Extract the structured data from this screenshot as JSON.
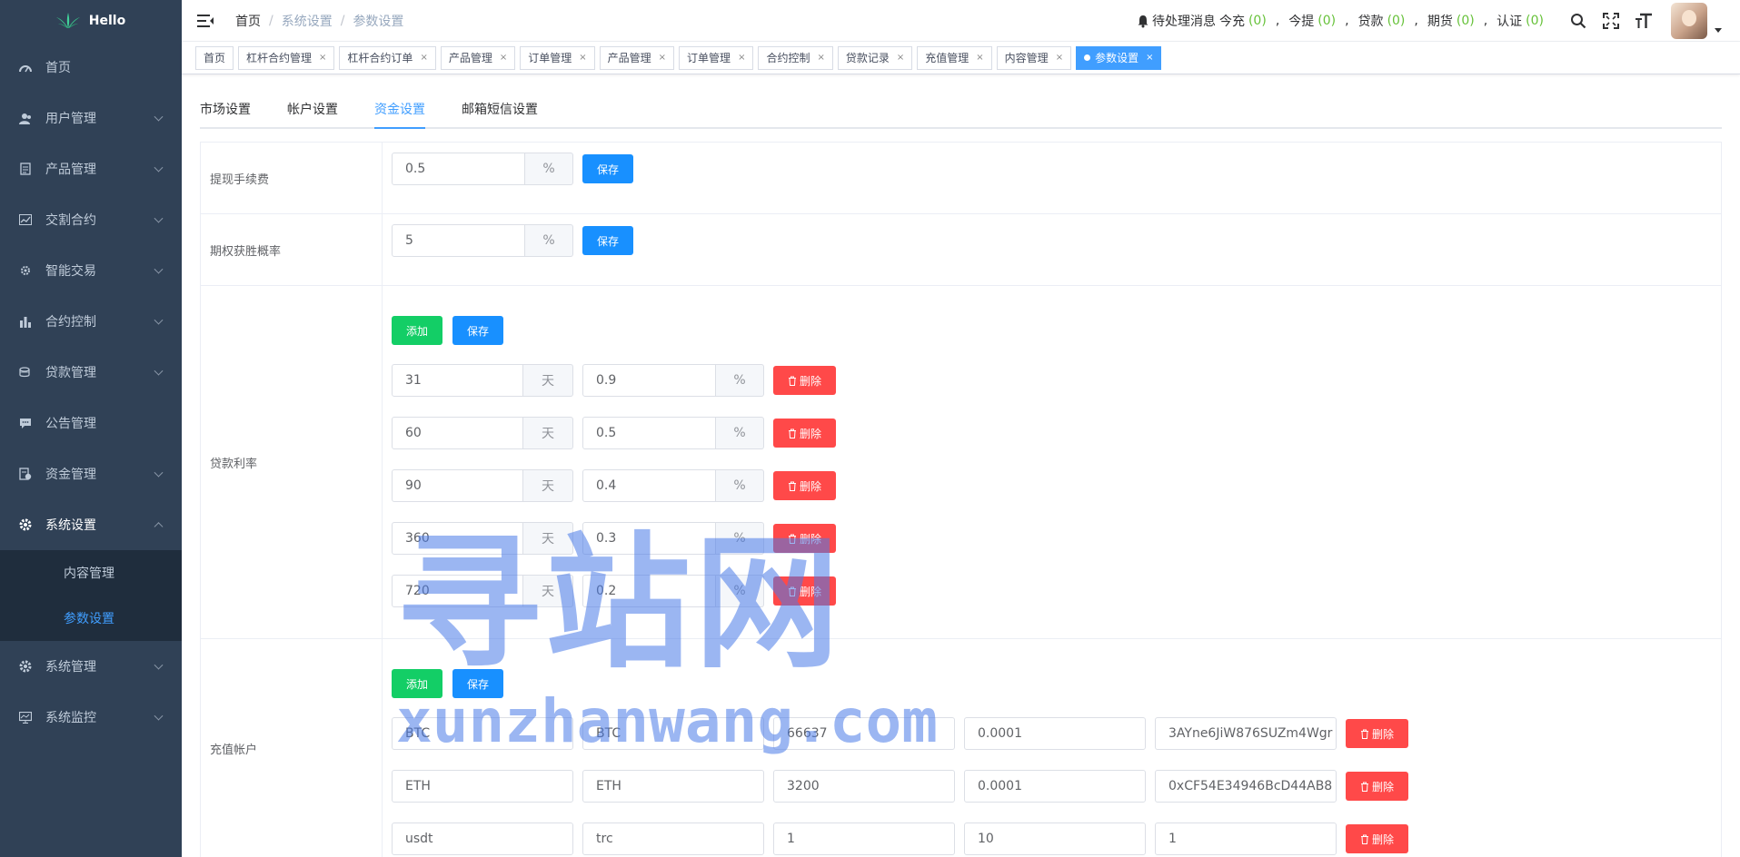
{
  "sidebar": {
    "logo_text": "Hello",
    "items": [
      {
        "label": "首页",
        "icon": "dashboard-icon"
      },
      {
        "label": "用户管理",
        "icon": "user-icon"
      },
      {
        "label": "产品管理",
        "icon": "document-icon"
      },
      {
        "label": "交割合约",
        "icon": "chart-line-icon"
      },
      {
        "label": "智能交易",
        "icon": "gear-icon"
      },
      {
        "label": "合约控制",
        "icon": "bar-chart-icon"
      },
      {
        "label": "贷款管理",
        "icon": "coins-icon"
      },
      {
        "label": "公告管理",
        "icon": "message-icon"
      },
      {
        "label": "资金管理",
        "icon": "money-icon"
      },
      {
        "label": "系统设置",
        "icon": "settings-icon"
      },
      {
        "label": "系统管理",
        "icon": "settings-icon"
      },
      {
        "label": "系统监控",
        "icon": "monitor-icon"
      }
    ],
    "submenu": [
      {
        "label": "内容管理"
      },
      {
        "label": "参数设置"
      }
    ]
  },
  "navbar": {
    "breadcrumb": [
      "首页",
      "系统设置",
      "参数设置"
    ],
    "notice_label": "待处理消息",
    "counters": [
      {
        "label": "今充",
        "value": "(0)"
      },
      {
        "label": "今提",
        "value": "(0)"
      },
      {
        "label": "贷款",
        "value": "(0)"
      },
      {
        "label": "期货",
        "value": "(0)"
      },
      {
        "label": "认证",
        "value": "(0)"
      }
    ],
    "comma": ","
  },
  "tags": [
    {
      "label": "首页"
    },
    {
      "label": "杠杆合约管理"
    },
    {
      "label": "杠杆合约订单"
    },
    {
      "label": "产品管理"
    },
    {
      "label": "订单管理"
    },
    {
      "label": "产品管理"
    },
    {
      "label": "订单管理"
    },
    {
      "label": "合约控制"
    },
    {
      "label": "贷款记录"
    },
    {
      "label": "充值管理"
    },
    {
      "label": "内容管理"
    },
    {
      "label": "参数设置"
    }
  ],
  "tag_close": "×",
  "tabs": [
    {
      "label": "市场设置"
    },
    {
      "label": "帐户设置"
    },
    {
      "label": "资金设置"
    },
    {
      "label": "邮箱短信设置"
    }
  ],
  "buttons": {
    "save": "保存",
    "add": "添加",
    "delete": "删除"
  },
  "withdraw_fee": {
    "label": "提现手续费",
    "value": "0.5",
    "unit": "%"
  },
  "option_win_rate": {
    "label": "期权获胜概率",
    "value": "5",
    "unit": "%"
  },
  "loan_rate": {
    "label": "贷款利率",
    "day_unit": "天",
    "pct_unit": "%",
    "rows": [
      {
        "days": "31",
        "rate": "0.9"
      },
      {
        "days": "60",
        "rate": "0.5"
      },
      {
        "days": "90",
        "rate": "0.4"
      },
      {
        "days": "360",
        "rate": "0.3"
      },
      {
        "days": "720",
        "rate": "0.2"
      }
    ]
  },
  "recharge_accounts": {
    "label": "充值帐户",
    "rows": [
      {
        "name": "BTC",
        "coin": "BTC",
        "price": "66637",
        "min": "0.0001",
        "address": "3AYne6JiW876SUZm4Wgr"
      },
      {
        "name": "ETH",
        "coin": "ETH",
        "price": "3200",
        "min": "0.0001",
        "address": "0xCF54E34946BcD44AB8"
      },
      {
        "name": "usdt",
        "coin": "trc",
        "price": "1",
        "min": "10",
        "address": "1"
      }
    ]
  },
  "watermark": {
    "big": "寻站网",
    "small": "xunzhanwang.com"
  }
}
